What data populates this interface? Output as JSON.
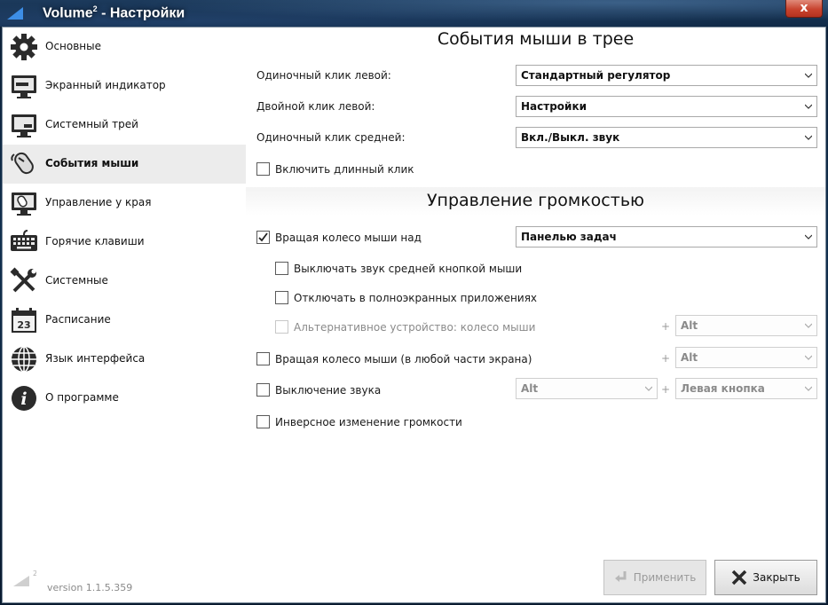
{
  "window": {
    "title": "Volume² - Настройки",
    "title_main": "Volume",
    "title_sup": "2",
    "title_rest": " - Настройки",
    "close_label": "x"
  },
  "sidebar": {
    "items": [
      {
        "label": "Основные",
        "icon": "gear-icon"
      },
      {
        "label": "Экранный индикатор",
        "icon": "monitor-icon"
      },
      {
        "label": "Системный трей",
        "icon": "tray-icon"
      },
      {
        "label": "События мыши",
        "icon": "mouse-icon"
      },
      {
        "label": "Управление у края",
        "icon": "screen-edge-icon"
      },
      {
        "label": "Горячие клавиши",
        "icon": "keyboard-icon"
      },
      {
        "label": "Системные",
        "icon": "tools-icon"
      },
      {
        "label": "Расписание",
        "icon": "calendar-icon"
      },
      {
        "label": "Язык интерфейса",
        "icon": "globe-icon"
      },
      {
        "label": "О программе",
        "icon": "info-icon"
      }
    ],
    "active_index": 3,
    "calendar_day": "23",
    "version": "version 1.1.5.359",
    "logo_sup": "2"
  },
  "tray": {
    "title": "События мыши в трее",
    "left_click_label": "Одиночный клик левой:",
    "left_click_value": "Стандартный регулятор",
    "double_click_label": "Двойной клик левой:",
    "double_click_value": "Настройки",
    "middle_click_label": "Одиночный клик средней:",
    "middle_click_value": "Вкл./Выкл. звук",
    "long_click_label": "Включить длинный клик",
    "long_click_checked": false
  },
  "volume": {
    "title": "Управление громкостью",
    "wheel_over_label": "Вращая колесо мыши над",
    "wheel_over_checked": true,
    "wheel_over_value": "Панелью задач",
    "mute_middle_label": "Выключать звук средней кнопкой мыши",
    "mute_middle_checked": false,
    "fullscreen_label": "Отключать в полноэкранных приложениях",
    "fullscreen_checked": false,
    "alt_device_label": "Альтернативное устройство: колесо мыши",
    "alt_device_checked": false,
    "alt_device_key": "Alt",
    "wheel_anywhere_label": "Вращая колесо мыши (в любой части экрана)",
    "wheel_anywhere_checked": false,
    "wheel_anywhere_key": "Alt",
    "mute_label": "Выключение звука",
    "mute_checked": false,
    "mute_key": "Alt",
    "mute_button": "Левая кнопка",
    "inverse_label": "Инверсное изменение громкости",
    "inverse_checked": false,
    "plus": "+"
  },
  "buttons": {
    "apply": "Применить",
    "close": "Закрыть"
  }
}
